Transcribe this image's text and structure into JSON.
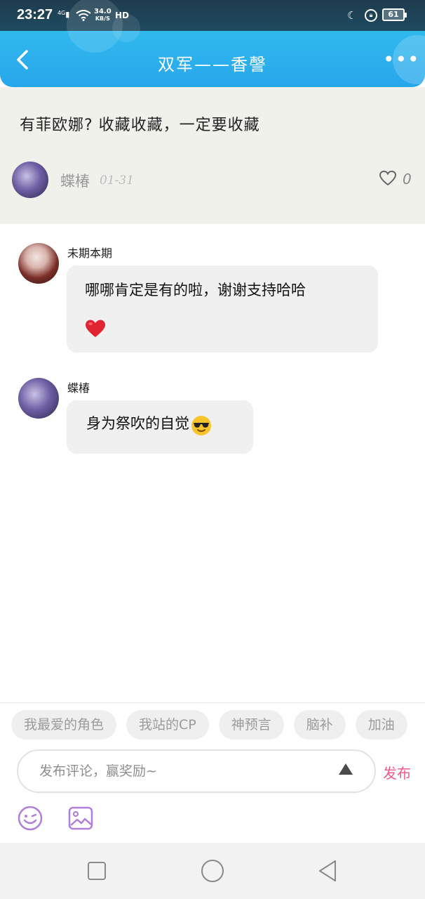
{
  "status_bar": {
    "time": "23:27",
    "network": "4G",
    "speed_value": "34.0",
    "speed_unit": "KB/S",
    "hd": "HD",
    "battery": "61"
  },
  "header": {
    "title": "双军——香謦",
    "back_icon": "chevron-left-icon",
    "more_icon": "more-dots-icon"
  },
  "post": {
    "text": "有菲欧娜? 收藏收藏，一定要收藏",
    "author": "蝶椿",
    "date": "01-31",
    "like_count": "0"
  },
  "comments": [
    {
      "name": "未期本期",
      "text": "哪哪肯定是有的啦，谢谢支持哈哈",
      "emoji": "red-heart-icon"
    },
    {
      "name": "蝶椿",
      "text": "身为祭吹的自觉",
      "emoji": "sunglasses-face-icon"
    }
  ],
  "quick_tags": [
    "我最爱的角色",
    "我站的CP",
    "神预言",
    "脑补",
    "加油"
  ],
  "composer": {
    "placeholder": "发布评论，赢奖励~",
    "publish_label": "发布"
  },
  "colors": {
    "header_blue": "#2fb3ef",
    "publish_pink": "#f05a8a",
    "icon_purple": "#b27fd8",
    "post_bg": "#f1f1ec"
  }
}
